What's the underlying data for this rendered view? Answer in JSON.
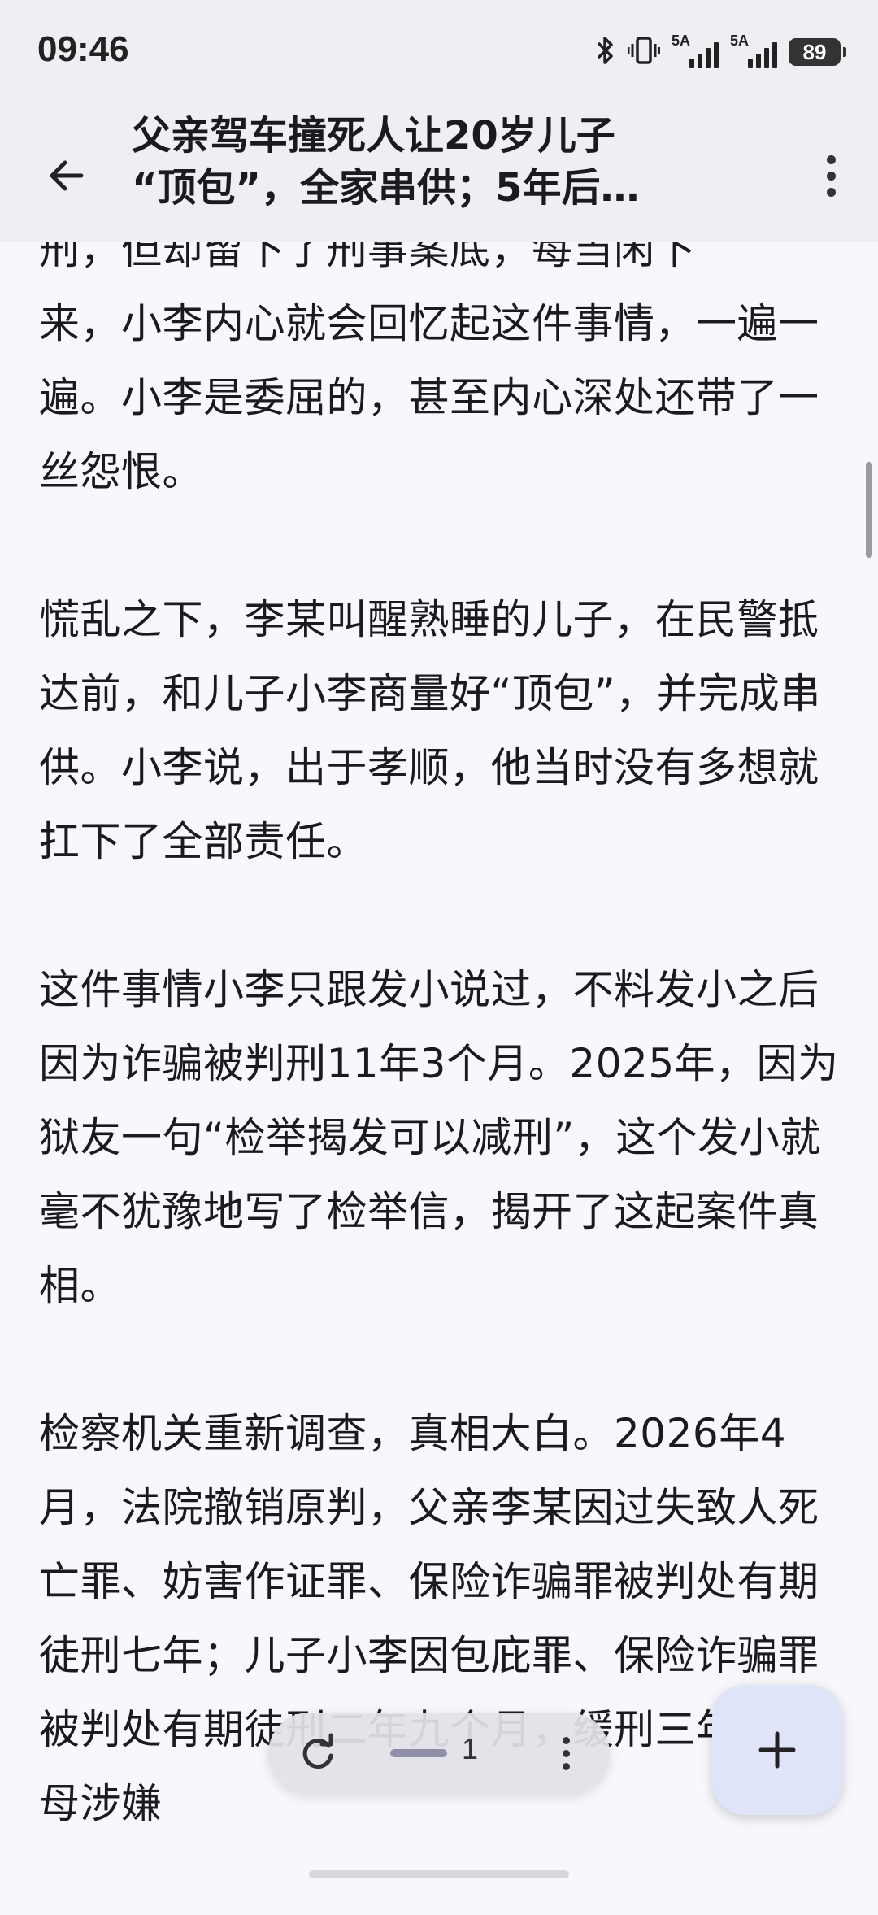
{
  "status": {
    "time": "09:46",
    "signal1_label": "5A",
    "signal2_label": "5A",
    "battery": "89"
  },
  "header": {
    "title_line1": "父亲驾车撞死人让20岁儿子",
    "title_line2": "“顶包”，全家串供；5年后…"
  },
  "article": {
    "partial_top": "刑，但却留下了刑事案底，每当闲下",
    "paragraphs": [
      "来，小李内心就会回忆起这件事情，一遍一遍。小李是委屈的，甚至内心深处还带了一丝怨恨。",
      "慌乱之下，李某叫醒熟睡的儿子，在民警抵达前，和儿子小李商量好“顶包”，并完成串供。小李说，出于孝顺，他当时没有多想就扛下了全部责任。",
      "这件事情小李只跟发小说过，不料发小之后因为诈骗被判刑11年3个月。2025年，因为狱友一句“检举揭发可以减刑”，这个发小就毫不犹豫地写了检举信，揭开了这起案件真相。",
      "检察机关重新调查，真相大白。2026年4月，法院撤销原判，父亲李某因过失致人死亡罪、妨害作证罪、保险诈骗罪被判处有期徒刑七年；儿子小李因包庇罪、保险诈骗罪被判处有期徒刑二年九个月，缓刑三年。李母涉嫌"
    ]
  },
  "pager": {
    "page": "1"
  },
  "icons": {
    "back": "arrow-left-icon",
    "more": "more-vert-icon",
    "reload": "refresh-icon",
    "fab": "plus-icon"
  }
}
